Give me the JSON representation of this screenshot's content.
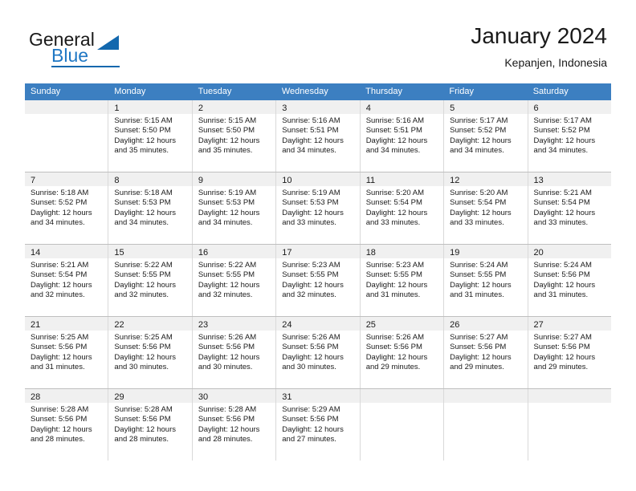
{
  "brand": {
    "general": "General",
    "blue": "Blue",
    "triangle_color": "#1368ae",
    "blue_color": "#1f77c4"
  },
  "header": {
    "title": "January 2024",
    "subtitle": "Kepanjen, Indonesia"
  },
  "theme": {
    "header_row_bg": "#3c7fc1",
    "daynum_bg": "#f0f0f0",
    "grid_line": "#d9d9d9",
    "week_divider": "#bfbfbf"
  },
  "weekdays": [
    "Sunday",
    "Monday",
    "Tuesday",
    "Wednesday",
    "Thursday",
    "Friday",
    "Saturday"
  ],
  "weeks": [
    [
      {
        "day": "",
        "sunrise": "",
        "sunset": "",
        "daylight": "",
        "empty": true
      },
      {
        "day": "1",
        "sunrise": "Sunrise: 5:15 AM",
        "sunset": "Sunset: 5:50 PM",
        "daylight": "Daylight: 12 hours and 35 minutes."
      },
      {
        "day": "2",
        "sunrise": "Sunrise: 5:15 AM",
        "sunset": "Sunset: 5:50 PM",
        "daylight": "Daylight: 12 hours and 35 minutes."
      },
      {
        "day": "3",
        "sunrise": "Sunrise: 5:16 AM",
        "sunset": "Sunset: 5:51 PM",
        "daylight": "Daylight: 12 hours and 34 minutes."
      },
      {
        "day": "4",
        "sunrise": "Sunrise: 5:16 AM",
        "sunset": "Sunset: 5:51 PM",
        "daylight": "Daylight: 12 hours and 34 minutes."
      },
      {
        "day": "5",
        "sunrise": "Sunrise: 5:17 AM",
        "sunset": "Sunset: 5:52 PM",
        "daylight": "Daylight: 12 hours and 34 minutes."
      },
      {
        "day": "6",
        "sunrise": "Sunrise: 5:17 AM",
        "sunset": "Sunset: 5:52 PM",
        "daylight": "Daylight: 12 hours and 34 minutes."
      }
    ],
    [
      {
        "day": "7",
        "sunrise": "Sunrise: 5:18 AM",
        "sunset": "Sunset: 5:52 PM",
        "daylight": "Daylight: 12 hours and 34 minutes."
      },
      {
        "day": "8",
        "sunrise": "Sunrise: 5:18 AM",
        "sunset": "Sunset: 5:53 PM",
        "daylight": "Daylight: 12 hours and 34 minutes."
      },
      {
        "day": "9",
        "sunrise": "Sunrise: 5:19 AM",
        "sunset": "Sunset: 5:53 PM",
        "daylight": "Daylight: 12 hours and 34 minutes."
      },
      {
        "day": "10",
        "sunrise": "Sunrise: 5:19 AM",
        "sunset": "Sunset: 5:53 PM",
        "daylight": "Daylight: 12 hours and 33 minutes."
      },
      {
        "day": "11",
        "sunrise": "Sunrise: 5:20 AM",
        "sunset": "Sunset: 5:54 PM",
        "daylight": "Daylight: 12 hours and 33 minutes."
      },
      {
        "day": "12",
        "sunrise": "Sunrise: 5:20 AM",
        "sunset": "Sunset: 5:54 PM",
        "daylight": "Daylight: 12 hours and 33 minutes."
      },
      {
        "day": "13",
        "sunrise": "Sunrise: 5:21 AM",
        "sunset": "Sunset: 5:54 PM",
        "daylight": "Daylight: 12 hours and 33 minutes."
      }
    ],
    [
      {
        "day": "14",
        "sunrise": "Sunrise: 5:21 AM",
        "sunset": "Sunset: 5:54 PM",
        "daylight": "Daylight: 12 hours and 32 minutes."
      },
      {
        "day": "15",
        "sunrise": "Sunrise: 5:22 AM",
        "sunset": "Sunset: 5:55 PM",
        "daylight": "Daylight: 12 hours and 32 minutes."
      },
      {
        "day": "16",
        "sunrise": "Sunrise: 5:22 AM",
        "sunset": "Sunset: 5:55 PM",
        "daylight": "Daylight: 12 hours and 32 minutes."
      },
      {
        "day": "17",
        "sunrise": "Sunrise: 5:23 AM",
        "sunset": "Sunset: 5:55 PM",
        "daylight": "Daylight: 12 hours and 32 minutes."
      },
      {
        "day": "18",
        "sunrise": "Sunrise: 5:23 AM",
        "sunset": "Sunset: 5:55 PM",
        "daylight": "Daylight: 12 hours and 31 minutes."
      },
      {
        "day": "19",
        "sunrise": "Sunrise: 5:24 AM",
        "sunset": "Sunset: 5:55 PM",
        "daylight": "Daylight: 12 hours and 31 minutes."
      },
      {
        "day": "20",
        "sunrise": "Sunrise: 5:24 AM",
        "sunset": "Sunset: 5:56 PM",
        "daylight": "Daylight: 12 hours and 31 minutes."
      }
    ],
    [
      {
        "day": "21",
        "sunrise": "Sunrise: 5:25 AM",
        "sunset": "Sunset: 5:56 PM",
        "daylight": "Daylight: 12 hours and 31 minutes."
      },
      {
        "day": "22",
        "sunrise": "Sunrise: 5:25 AM",
        "sunset": "Sunset: 5:56 PM",
        "daylight": "Daylight: 12 hours and 30 minutes."
      },
      {
        "day": "23",
        "sunrise": "Sunrise: 5:26 AM",
        "sunset": "Sunset: 5:56 PM",
        "daylight": "Daylight: 12 hours and 30 minutes."
      },
      {
        "day": "24",
        "sunrise": "Sunrise: 5:26 AM",
        "sunset": "Sunset: 5:56 PM",
        "daylight": "Daylight: 12 hours and 30 minutes."
      },
      {
        "day": "25",
        "sunrise": "Sunrise: 5:26 AM",
        "sunset": "Sunset: 5:56 PM",
        "daylight": "Daylight: 12 hours and 29 minutes."
      },
      {
        "day": "26",
        "sunrise": "Sunrise: 5:27 AM",
        "sunset": "Sunset: 5:56 PM",
        "daylight": "Daylight: 12 hours and 29 minutes."
      },
      {
        "day": "27",
        "sunrise": "Sunrise: 5:27 AM",
        "sunset": "Sunset: 5:56 PM",
        "daylight": "Daylight: 12 hours and 29 minutes."
      }
    ],
    [
      {
        "day": "28",
        "sunrise": "Sunrise: 5:28 AM",
        "sunset": "Sunset: 5:56 PM",
        "daylight": "Daylight: 12 hours and 28 minutes."
      },
      {
        "day": "29",
        "sunrise": "Sunrise: 5:28 AM",
        "sunset": "Sunset: 5:56 PM",
        "daylight": "Daylight: 12 hours and 28 minutes."
      },
      {
        "day": "30",
        "sunrise": "Sunrise: 5:28 AM",
        "sunset": "Sunset: 5:56 PM",
        "daylight": "Daylight: 12 hours and 28 minutes."
      },
      {
        "day": "31",
        "sunrise": "Sunrise: 5:29 AM",
        "sunset": "Sunset: 5:56 PM",
        "daylight": "Daylight: 12 hours and 27 minutes."
      },
      {
        "day": "",
        "sunrise": "",
        "sunset": "",
        "daylight": "",
        "empty": true
      },
      {
        "day": "",
        "sunrise": "",
        "sunset": "",
        "daylight": "",
        "empty": true
      },
      {
        "day": "",
        "sunrise": "",
        "sunset": "",
        "daylight": "",
        "empty": true
      }
    ]
  ]
}
